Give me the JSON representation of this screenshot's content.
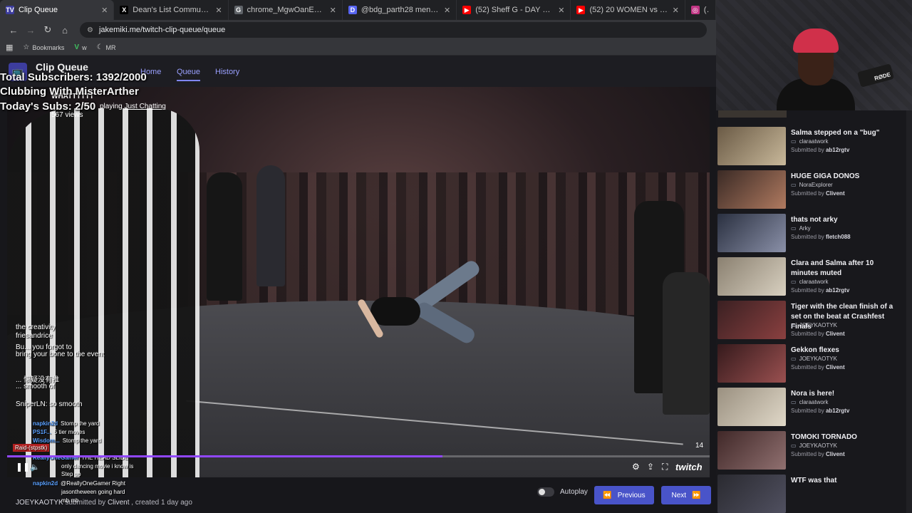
{
  "browser": {
    "tabs": [
      {
        "title": "Clip Queue",
        "favicon": "TV",
        "color": "#3d3d9e",
        "active": true
      },
      {
        "title": "Dean's List Community / X",
        "favicon": "X",
        "color": "#000000"
      },
      {
        "title": "chrome_MgwOanE3w5.png (42",
        "favicon": "G",
        "color": "#5f6368"
      },
      {
        "title": "@bdg_parth28 mentioned",
        "favicon": "D",
        "color": "#5865f2"
      },
      {
        "title": "(52) Sheff G - DAY N NITE Free",
        "favicon": "▶",
        "color": "#ff0000"
      },
      {
        "title": "(52) 20 WOMEN vs 2 SIDEMEN",
        "favicon": "▶",
        "color": "#ff0000"
      },
      {
        "title": "(9",
        "favicon": "◎",
        "color": "#c13584"
      }
    ],
    "url": "jakemiki.me/twitch-clip-queue/queue",
    "bookmarks": [
      {
        "label": "Bookmarks",
        "icon": "star-icon"
      },
      {
        "label": "w",
        "icon": "vine-icon"
      },
      {
        "label": "MR",
        "icon": "moon-icon"
      }
    ]
  },
  "app": {
    "brand": "Clip Queue",
    "nav": [
      {
        "label": "Home"
      },
      {
        "label": "Queue"
      },
      {
        "label": "History"
      }
    ]
  },
  "overlay": {
    "subs_total": "Total Subscribers: 1392/2000",
    "clubbing": "Clubbing With MisterArther",
    "subs_today": "Today's Subs: 2/50"
  },
  "clip": {
    "title": "WHATTTTTT",
    "playing_prefix": "playing",
    "category": "Just Chatting",
    "views": "567 views",
    "duration": "14",
    "progress": 0.62,
    "channel": "JOEYKAOTYK",
    "submitted_by_prefix": "submitted by",
    "submitter": "Clivent",
    "created": "created 1 day ago",
    "watermark": "twitch"
  },
  "controls": {
    "autoplay_label": "Autoplay",
    "previous_label": "Previous",
    "next_label": "Next"
  },
  "chat_overlay": [
    {
      "text": "the creativity"
    },
    {
      "text": "friesandrice"
    },
    {
      "text": "Bu... you forgot to"
    },
    {
      "text": "bring your bone to the event"
    },
    {
      "text": "... 懐疑没有推"
    },
    {
      "text": "... smooth of"
    },
    {
      "text": "SniperLN: so smooth"
    }
  ],
  "chat_small": [
    {
      "user": "napkin2d",
      "msg": "Stomp the yard"
    },
    {
      "user": "PS1F...",
      "msg": "5 tier moves"
    },
    {
      "user": "Wisdom...",
      "msg": "Stomp the yard"
    },
    {
      "user": "ReallyOneGamer",
      "msg": "THE HEAD SLIDE"
    },
    {
      "user": "",
      "msg": "only dancing movie i know is"
    },
    {
      "user": "",
      "msg": "Step up"
    },
    {
      "user": "napkin2d",
      "msg": "@ReallyOneGamer Right"
    },
    {
      "user": "",
      "msg": "jasontheween going hard"
    },
    {
      "user": "",
      "msg": "mb mb"
    }
  ],
  "chat_badge": "Raid-(stpstk)",
  "queue": [
    {
      "title": "Salma stepped on a \"bug\"",
      "channel": "claraatwork",
      "submitter": "ab12rgtv",
      "thumb": [
        "#6a5a45",
        "#c8b89a"
      ]
    },
    {
      "title": "HUGE GIGA DONOS",
      "channel": "NoraExplorer",
      "submitter": "Clivent",
      "thumb": [
        "#3a2a25",
        "#b07a60"
      ]
    },
    {
      "title": "thats not arky",
      "channel": "Arky",
      "submitter": "fletch088",
      "thumb": [
        "#2a3040",
        "#8a90a8"
      ]
    },
    {
      "title": "Clara and Salma after 10 minutes muted",
      "channel": "claraatwork",
      "submitter": "ab12rgtv",
      "thumb": [
        "#8a8070",
        "#d8d0c0"
      ]
    },
    {
      "title": "Tiger with the clean finish of a set on the beat at Crashfest Finals",
      "channel": "JOEYKAOTYK",
      "submitter": "Clivent",
      "thumb": [
        "#3a2022",
        "#8a4040"
      ]
    },
    {
      "title": "Gekkon flexes",
      "channel": "JOEYKAOTYK",
      "submitter": "Clivent",
      "thumb": [
        "#351a1c",
        "#9a5050"
      ]
    },
    {
      "title": "Nora is here!",
      "channel": "claraatwork",
      "submitter": "ab12rgtv",
      "thumb": [
        "#9a9080",
        "#e0d8c8"
      ]
    },
    {
      "title": "TOMOKI TORNADO",
      "channel": "JOEYKAOTYK",
      "submitter": "Clivent",
      "thumb": [
        "#402828",
        "#907070"
      ]
    },
    {
      "title": "WTF was that",
      "channel": "",
      "submitter": "",
      "thumb": [
        "#2a2a30",
        "#505060"
      ]
    }
  ],
  "submitted_by_label": "Submitted by",
  "webcam": {
    "mic_label": "RØDE"
  },
  "colors": {
    "accent": "#4954c9",
    "twitch": "#9147ff",
    "nav_link": "#9aa0ff"
  }
}
